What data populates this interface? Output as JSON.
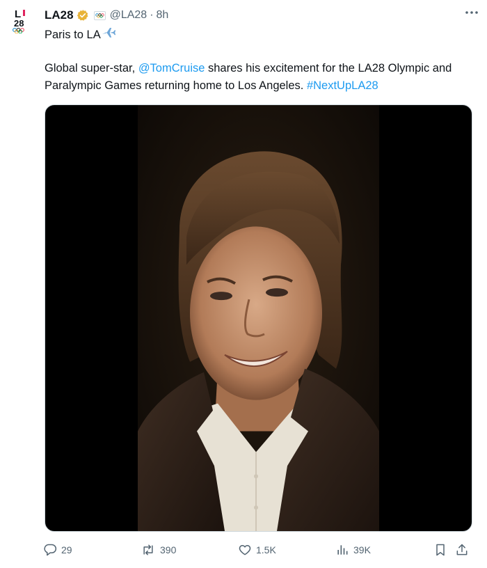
{
  "tweet": {
    "display_name": "LA28",
    "handle": "@LA28",
    "separator": "·",
    "time": "8h",
    "line1": "Paris to LA",
    "body_prefix": "Global super-star, ",
    "mention": "@TomCruise",
    "body_middle": " shares his excitement for the LA28 Olympic and Paralympic Games returning home to Los Angeles. ",
    "hashtag": "#NextUpLA28"
  },
  "avatar": {
    "logo_text_top": "L",
    "logo_text_bottom": "28"
  },
  "actions": {
    "replies": "29",
    "reposts": "390",
    "likes": "1.5K",
    "views": "39K"
  },
  "icons": {
    "verified": "gold-verified-badge-icon",
    "affiliate": "olympic-rings-affiliate-icon",
    "more": "more-dots-icon",
    "plane": "airplane-emoji-icon",
    "reply": "reply-bubble-icon",
    "repost": "repost-arrows-icon",
    "like": "heart-icon",
    "views": "bar-chart-icon",
    "bookmark": "bookmark-icon",
    "share": "share-upload-icon"
  },
  "colors": {
    "accent": "#1d9bf0",
    "text": "#0f1419",
    "secondary": "#536471",
    "verified_gold": "#e8b339"
  }
}
